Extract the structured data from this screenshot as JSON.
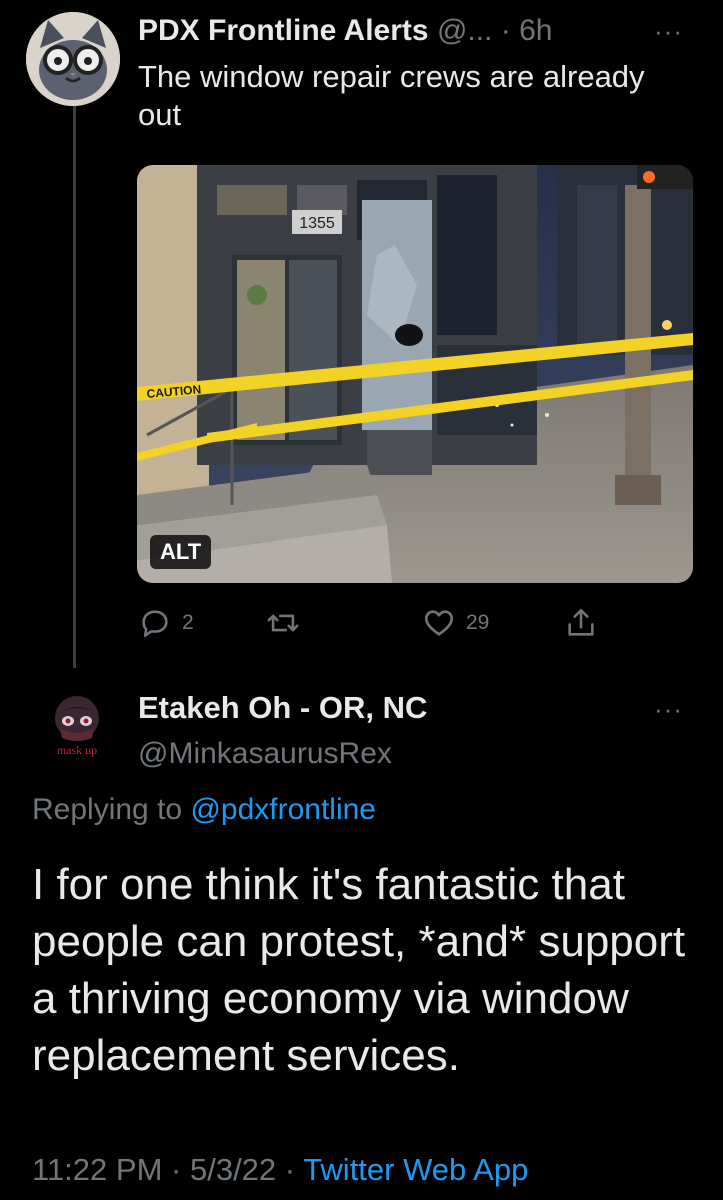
{
  "tweet1": {
    "display_name": "PDX Frontline Alerts",
    "handle": "@...",
    "separator": "·",
    "time": "6h",
    "more": "···",
    "text": "The window repair crews are already out",
    "media": {
      "alt_badge": "ALT",
      "address_number": "1355",
      "tape_text": "CAUTION"
    },
    "actions": {
      "replies": "2",
      "retweets": "",
      "likes": "29"
    }
  },
  "tweet2": {
    "display_name": "Etakeh Oh - OR, NC",
    "handle": "@MinkasaurusRex",
    "more": "···",
    "avatar_caption": "mask up",
    "replying_prefix": "Replying to",
    "replying_mention": "@pdxfrontline",
    "text": "I for one think it's fantastic that people can protest, *and* support a thriving economy via window replacement services.",
    "time": "11:22 PM",
    "date": "5/3/22",
    "sep": "·",
    "source": "Twitter Web App"
  },
  "colors": {
    "background": "#000000",
    "primary_text": "#e7e9ea",
    "secondary_text": "#71767b",
    "link": "#1d9bf0",
    "caution_tape": "#f2d325"
  }
}
